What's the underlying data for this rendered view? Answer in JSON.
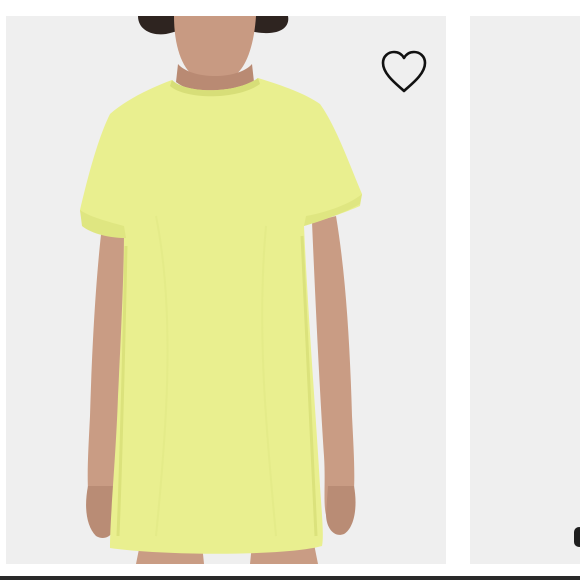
{
  "product": {
    "alt_text": "",
    "dress_color": "#e9ef8f"
  },
  "favorite": {
    "icon": "heart-outline-icon",
    "state": "not-favorited"
  },
  "gallery": {
    "current_slide": 1
  }
}
